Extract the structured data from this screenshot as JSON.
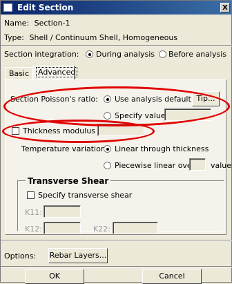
{
  "window": {
    "title": "Edit Section",
    "close_symbol": "X"
  },
  "section": {
    "name_label": "Name:",
    "name_value": "Section-1",
    "type_label": "Type:",
    "type_value": "Shell / Continuum Shell, Homogeneous"
  },
  "integration": {
    "label": "Section integration:",
    "options": [
      "During analysis",
      "Before analysis"
    ],
    "selected": "During analysis"
  },
  "tabs": [
    "Basic",
    "Advanced"
  ],
  "active_tab": "Advanced",
  "poisson": {
    "label": "Section Poisson's ratio:",
    "option_default": "Use analysis default",
    "option_specify": "Specify value:",
    "selected": "Use analysis default",
    "tip_button": "Tip...",
    "value": ""
  },
  "thickness_modulus": {
    "label": "Thickness modulus",
    "checked": false,
    "value": ""
  },
  "temperature": {
    "label": "Temperature variation:",
    "option_linear": "Linear through thickness",
    "option_piecewise": "Piecewise linear over",
    "values_suffix": "values",
    "selected": "Linear through thickness",
    "count": ""
  },
  "transverse_shear": {
    "title": "Transverse Shear",
    "specify_label": "Specify transverse shear",
    "checked": false,
    "k11_label": "K11:",
    "k12_label": "K12:",
    "k22_label": "K22:",
    "k11": "",
    "k12": "",
    "k22": ""
  },
  "options": {
    "label": "Options:",
    "rebar_button": "Rebar Layers..."
  },
  "footer": {
    "ok": "OK",
    "cancel": "Cancel"
  },
  "annotation_color": "#e00000"
}
